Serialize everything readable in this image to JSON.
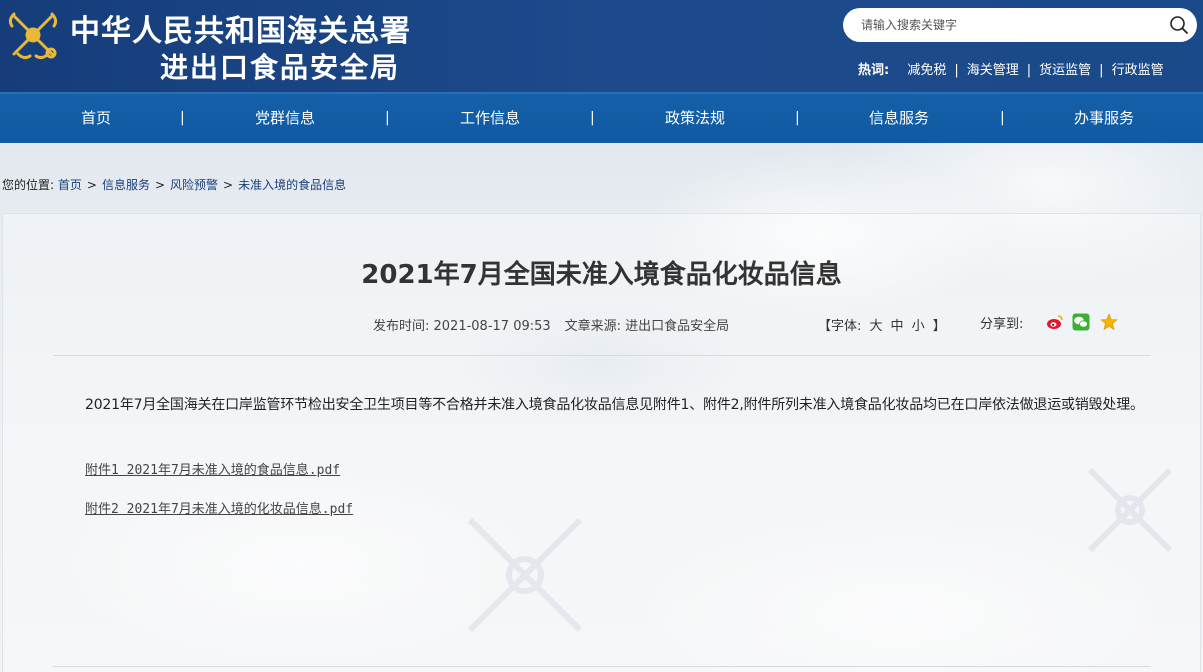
{
  "header": {
    "title_line1": "中华人民共和国海关总署",
    "title_line2": "进出口食品安全局",
    "search": {
      "placeholder": "请输入搜索关键字"
    },
    "hotwords": {
      "label": "热词:",
      "items": [
        "减免税",
        "海关管理",
        "货运监管",
        "行政监管"
      ],
      "separator": "|"
    }
  },
  "nav": {
    "items": [
      "首页",
      "党群信息",
      "工作信息",
      "政策法规",
      "信息服务",
      "办事服务"
    ],
    "separator": "|"
  },
  "breadcrumb": {
    "prefix": "您的位置:",
    "items": [
      "首页",
      "信息服务",
      "风险预警",
      "未准入境的食品信息"
    ],
    "arrow": ">"
  },
  "article": {
    "title": "2021年7月全国未准入境食品化妆品信息",
    "publish_time": "发布时间: 2021-08-17 09:53",
    "source": "文章来源: 进出口食品安全局",
    "font_control": {
      "open": "【字体:",
      "sizes": [
        "大",
        "中",
        "小"
      ],
      "close": "】"
    },
    "share_label": "分享到:",
    "body": "2021年7月全国海关在口岸监管环节检出安全卫生项目等不合格并未准入境食品化妆品信息见附件1、附件2,附件所列未准入境食品化妆品均已在口岸依法做退运或销毁处理。",
    "attachments": [
      "附件1 2021年7月未准入境的食品信息.pdf",
      "附件2 2021年7月未准入境的化妆品信息.pdf"
    ]
  },
  "colors": {
    "header_bg": "#1c4a8c",
    "nav_bg": "#1560a8",
    "link": "#1a3f7a"
  }
}
